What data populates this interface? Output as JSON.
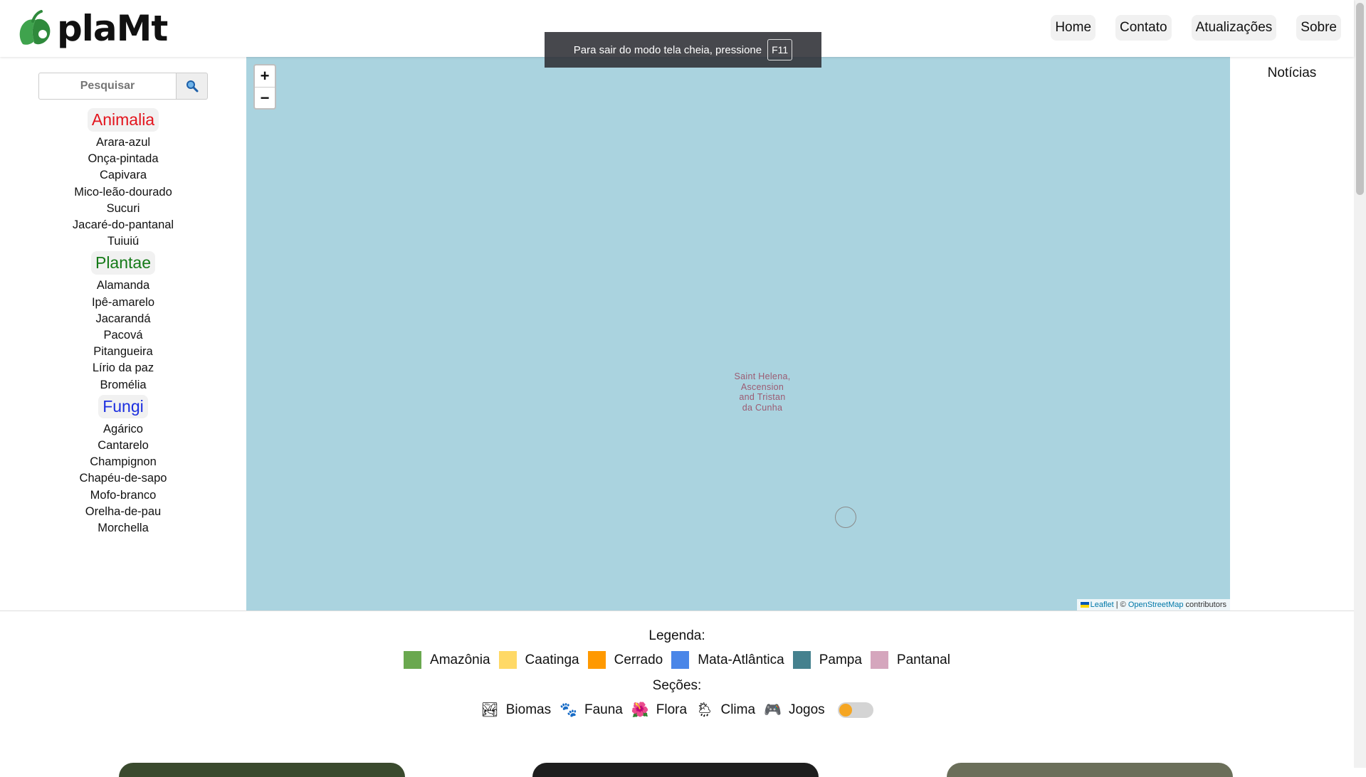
{
  "header": {
    "logo_text": "plaMt",
    "nav": [
      "Home",
      "Contato",
      "Atualizações",
      "Sobre"
    ]
  },
  "fullscreen_notice": {
    "text": "Para sair do modo tela cheia, pressione",
    "key": "F11"
  },
  "sidebar": {
    "search_placeholder": "Pesquisar",
    "groups": [
      {
        "title": "Animalia",
        "items": [
          "Arara-azul",
          "Onça-pintada",
          "Capivara",
          "Mico-leão-dourado",
          "Sucuri",
          "Jacaré-do-pantanal",
          "Tuiuiú"
        ]
      },
      {
        "title": "Plantae",
        "items": [
          "Alamanda",
          "Ipê-amarelo",
          "Jacarandá",
          "Pacová",
          "Pitangueira",
          "Lírio da paz",
          "Bromélia"
        ]
      },
      {
        "title": "Fungi",
        "items": [
          "Agárico",
          "Cantarelo",
          "Champignon",
          "Chapéu-de-sapo",
          "Mofo-branco",
          "Orelha-de-pau",
          "Morchella"
        ]
      }
    ]
  },
  "map": {
    "zoom_in": "+",
    "zoom_out": "−",
    "place_label": [
      "Saint Helena,",
      "Ascension",
      "and Tristan",
      "da Cunha"
    ],
    "attribution": {
      "leaflet": "Leaflet",
      "sep": " | © ",
      "osm": "OpenStreetMap",
      "contributors": " contributors"
    }
  },
  "news": {
    "title": "Notícias"
  },
  "legend": {
    "title": "Legenda:",
    "biomes": [
      {
        "name": "Amazônia",
        "color": "#6aa84f"
      },
      {
        "name": "Caatinga",
        "color": "#ffd966"
      },
      {
        "name": "Cerrado",
        "color": "#ff9900"
      },
      {
        "name": "Mata-Atlântica",
        "color": "#4a86e8"
      },
      {
        "name": "Pampa",
        "color": "#45818e"
      },
      {
        "name": "Pantanal",
        "color": "#d5a6bd"
      }
    ],
    "sections_title": "Seções:",
    "sections": [
      {
        "name": "Biomas",
        "icon": "🏞"
      },
      {
        "name": "Fauna",
        "icon": "🐾"
      },
      {
        "name": "Flora",
        "icon": "🌺"
      },
      {
        "name": "Clima",
        "icon": "🌦"
      },
      {
        "name": "Jogos",
        "icon": "🎮"
      }
    ]
  }
}
